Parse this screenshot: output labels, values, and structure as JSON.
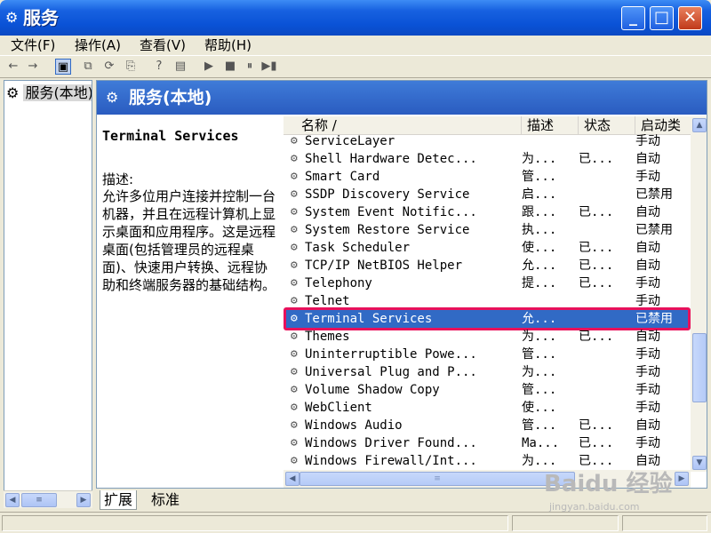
{
  "window": {
    "title": "服务",
    "title_icon": "gears-icon",
    "min_glyph": "_",
    "max_glyph": "□",
    "close_glyph": "✕"
  },
  "menu": [
    "文件(F)",
    "操作(A)",
    "查看(V)",
    "帮助(H)"
  ],
  "toolbar": {
    "back": "←",
    "forward": "→",
    "show_tree": "▣",
    "properties": "⧉",
    "refresh": "⟳",
    "export": "⎘",
    "help": "?",
    "console": "▤",
    "start": "▶",
    "stop": "■",
    "pause": "⏸",
    "restart": "▶▮"
  },
  "tree": {
    "item": "服务(本地)"
  },
  "banner": {
    "title": "服务(本地)"
  },
  "description": {
    "service_name": "Terminal Services",
    "label": "描述:",
    "text": "允许多位用户连接并控制一台机器，并且在远程计算机上显示桌面和应用程序。这是远程桌面(包括管理员的远程桌面)、快速用户转换、远程协助和终端服务器的基础结构。"
  },
  "list": {
    "columns": [
      "名称 /",
      "描述",
      "状态",
      "启动类"
    ],
    "rows": [
      {
        "name": "ServiceLayer",
        "desc": "",
        "status": "",
        "startup": "手动"
      },
      {
        "name": "Shell Hardware Detec...",
        "desc": "为...",
        "status": "已...",
        "startup": "自动"
      },
      {
        "name": "Smart Card",
        "desc": "管...",
        "status": "",
        "startup": "手动"
      },
      {
        "name": "SSDP Discovery Service",
        "desc": "启...",
        "status": "",
        "startup": "已禁用"
      },
      {
        "name": "System Event Notific...",
        "desc": "跟...",
        "status": "已...",
        "startup": "自动"
      },
      {
        "name": "System Restore Service",
        "desc": "执...",
        "status": "",
        "startup": "已禁用"
      },
      {
        "name": "Task Scheduler",
        "desc": "使...",
        "status": "已...",
        "startup": "自动"
      },
      {
        "name": "TCP/IP NetBIOS Helper",
        "desc": "允...",
        "status": "已...",
        "startup": "自动"
      },
      {
        "name": "Telephony",
        "desc": "提...",
        "status": "已...",
        "startup": "手动"
      },
      {
        "name": "Telnet",
        "desc": "",
        "status": "",
        "startup": "手动"
      },
      {
        "name": "Terminal Services",
        "desc": "允...",
        "status": "",
        "startup": "已禁用"
      },
      {
        "name": "Themes",
        "desc": "为...",
        "status": "已...",
        "startup": "自动"
      },
      {
        "name": "Uninterruptible Powe...",
        "desc": "管...",
        "status": "",
        "startup": "手动"
      },
      {
        "name": "Universal Plug and P...",
        "desc": "为...",
        "status": "",
        "startup": "手动"
      },
      {
        "name": "Volume Shadow Copy",
        "desc": "管...",
        "status": "",
        "startup": "手动"
      },
      {
        "name": "WebClient",
        "desc": "使...",
        "status": "",
        "startup": "手动"
      },
      {
        "name": "Windows Audio",
        "desc": "管...",
        "status": "已...",
        "startup": "自动"
      },
      {
        "name": "Windows Driver Found...",
        "desc": "Ma...",
        "status": "已...",
        "startup": "手动"
      },
      {
        "name": "Windows Firewall/Int...",
        "desc": "为...",
        "status": "已...",
        "startup": "自动"
      }
    ],
    "selected_index": 10,
    "row_icon": "gear-icon",
    "row_icon_glyph": "⚙",
    "scroll_up": "▲",
    "scroll_down": "▼",
    "scroll_left": "◀",
    "scroll_right": "▶",
    "scroll_grip": "≡"
  },
  "tabs": [
    "扩展",
    "标准"
  ],
  "active_tab": 0,
  "colors": {
    "titlebar": "#0a52d6",
    "banner": "#2a5cc0",
    "selection": "#316ac5",
    "highlight_box": "#e8115b"
  },
  "watermark": {
    "logo": "Baidu 经验",
    "url": "jingyan.baidu.com"
  }
}
